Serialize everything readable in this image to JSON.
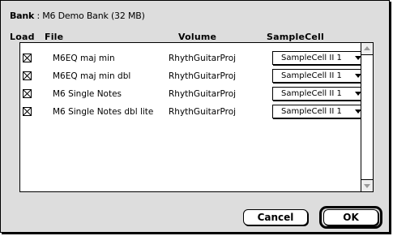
{
  "bank": {
    "label": "Bank",
    "separator": " : ",
    "value": "M6 Demo Bank (32 MB)"
  },
  "columns": {
    "load": "Load",
    "file": "File",
    "volume": "Volume",
    "samplecell": "SampleCell"
  },
  "rows": [
    {
      "checked": true,
      "file": "M6EQ maj min",
      "volume": "RhythGuitarProj",
      "samplecell": "SampleCell II  1"
    },
    {
      "checked": true,
      "file": "M6EQ maj min dbl",
      "volume": "RhythGuitarProj",
      "samplecell": "SampleCell II  1"
    },
    {
      "checked": true,
      "file": "M6 Single Notes",
      "volume": "RhythGuitarProj",
      "samplecell": "SampleCell II  1"
    },
    {
      "checked": true,
      "file": "M6 Single Notes dbl lite",
      "volume": "RhythGuitarProj",
      "samplecell": "SampleCell II  1"
    }
  ],
  "buttons": {
    "cancel": "Cancel",
    "ok": "OK"
  }
}
